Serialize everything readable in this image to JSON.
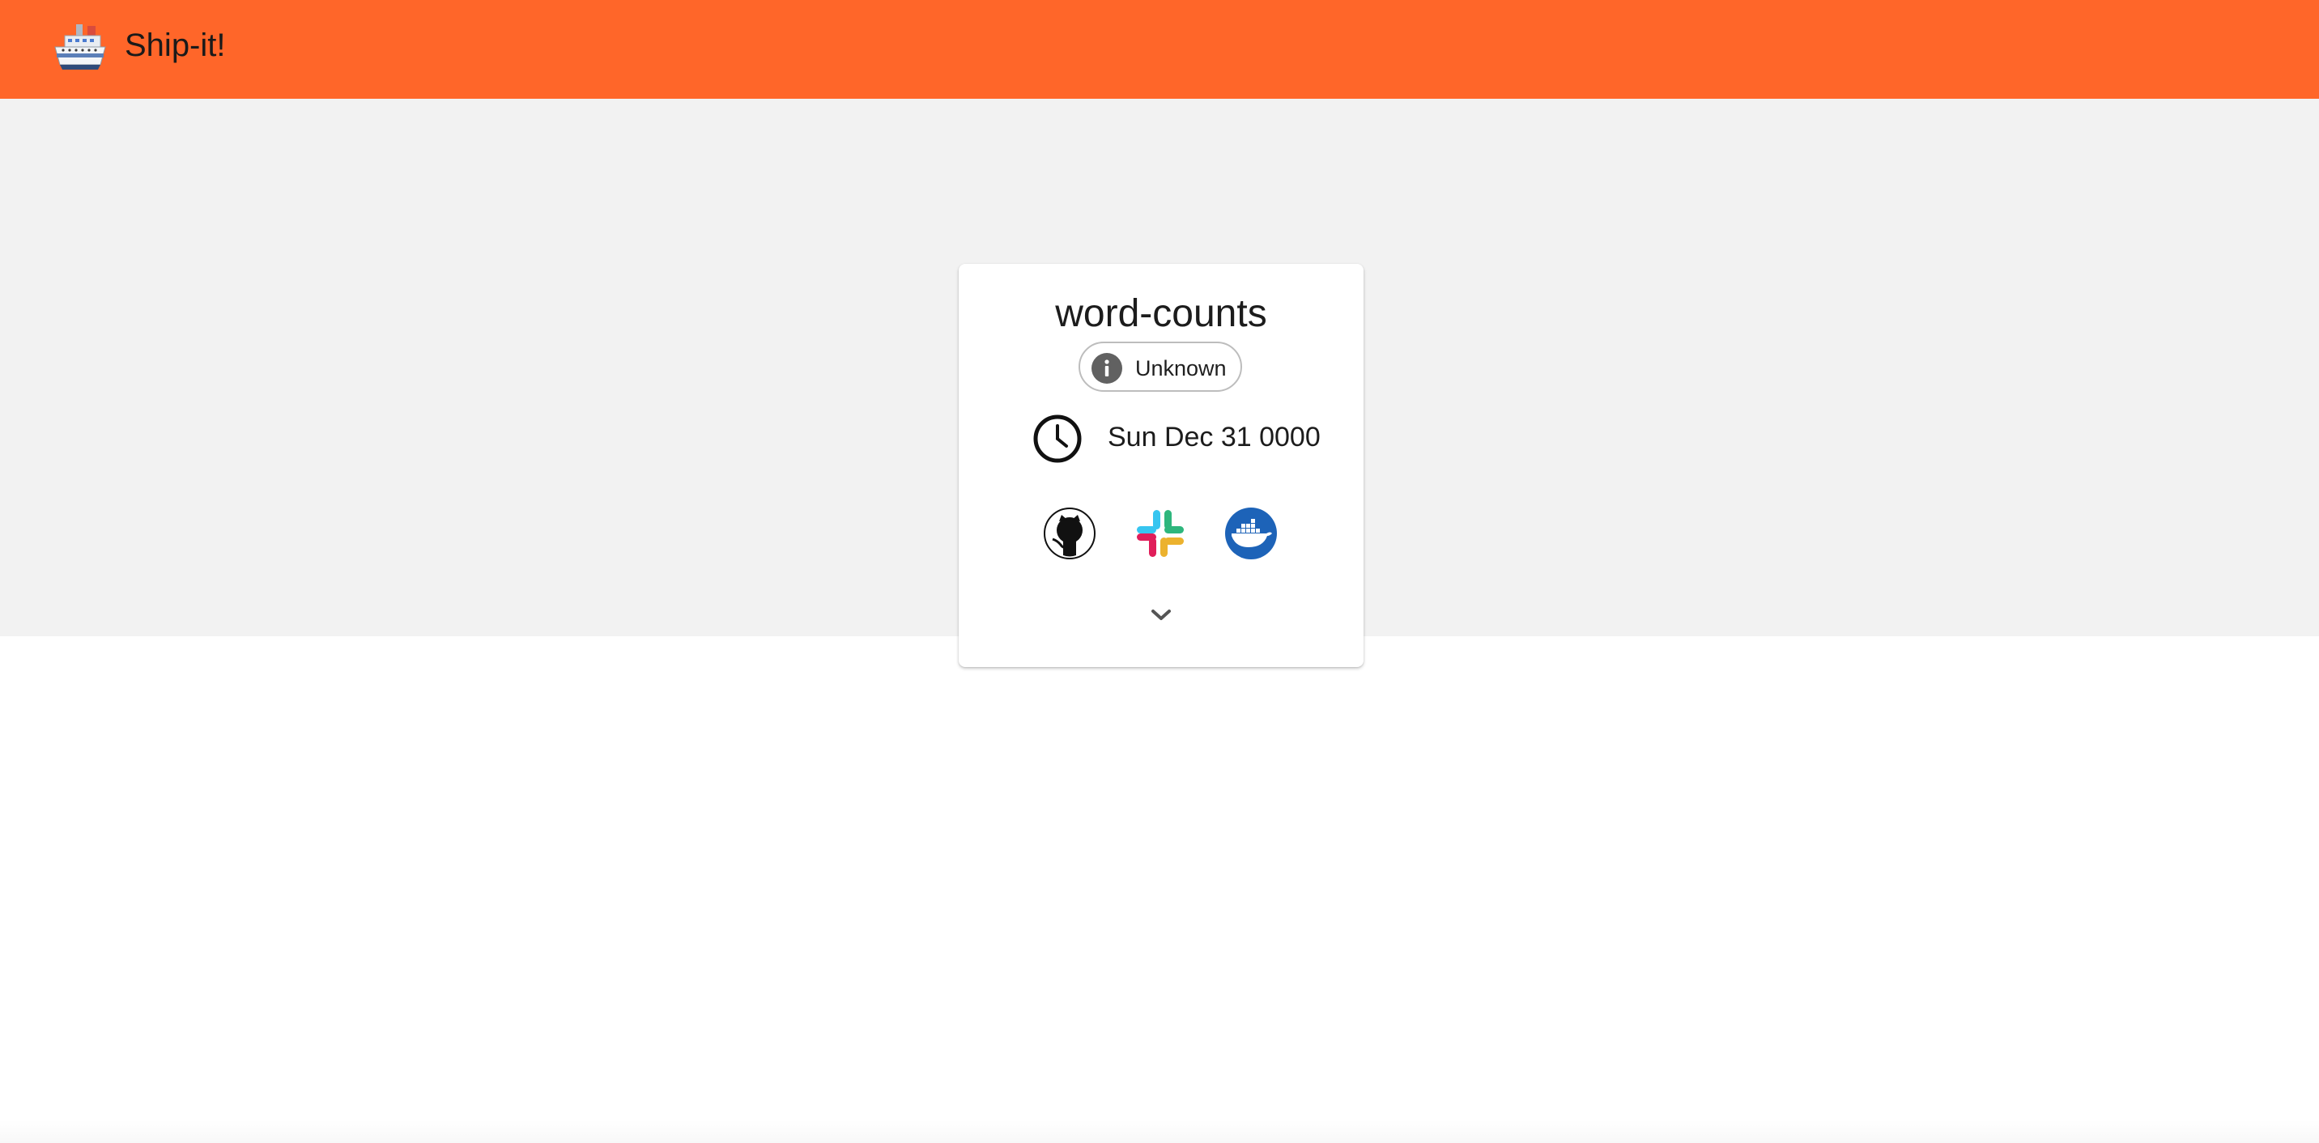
{
  "app": {
    "title": "Ship-it!"
  },
  "card": {
    "service_name": "word-counts",
    "status_label": "Unknown",
    "timestamp": "Sun Dec 31 0000"
  },
  "icons": {
    "logo": "ship-icon",
    "status": "info-icon",
    "time": "clock-icon",
    "links": [
      "github-icon",
      "slack-icon",
      "docker-icon"
    ],
    "expand": "chevron-down-icon"
  },
  "colors": {
    "app_bar": "#ff6629",
    "background": "#f2f2f2",
    "card": "#ffffff",
    "docker_blue": "#1d63b8"
  }
}
